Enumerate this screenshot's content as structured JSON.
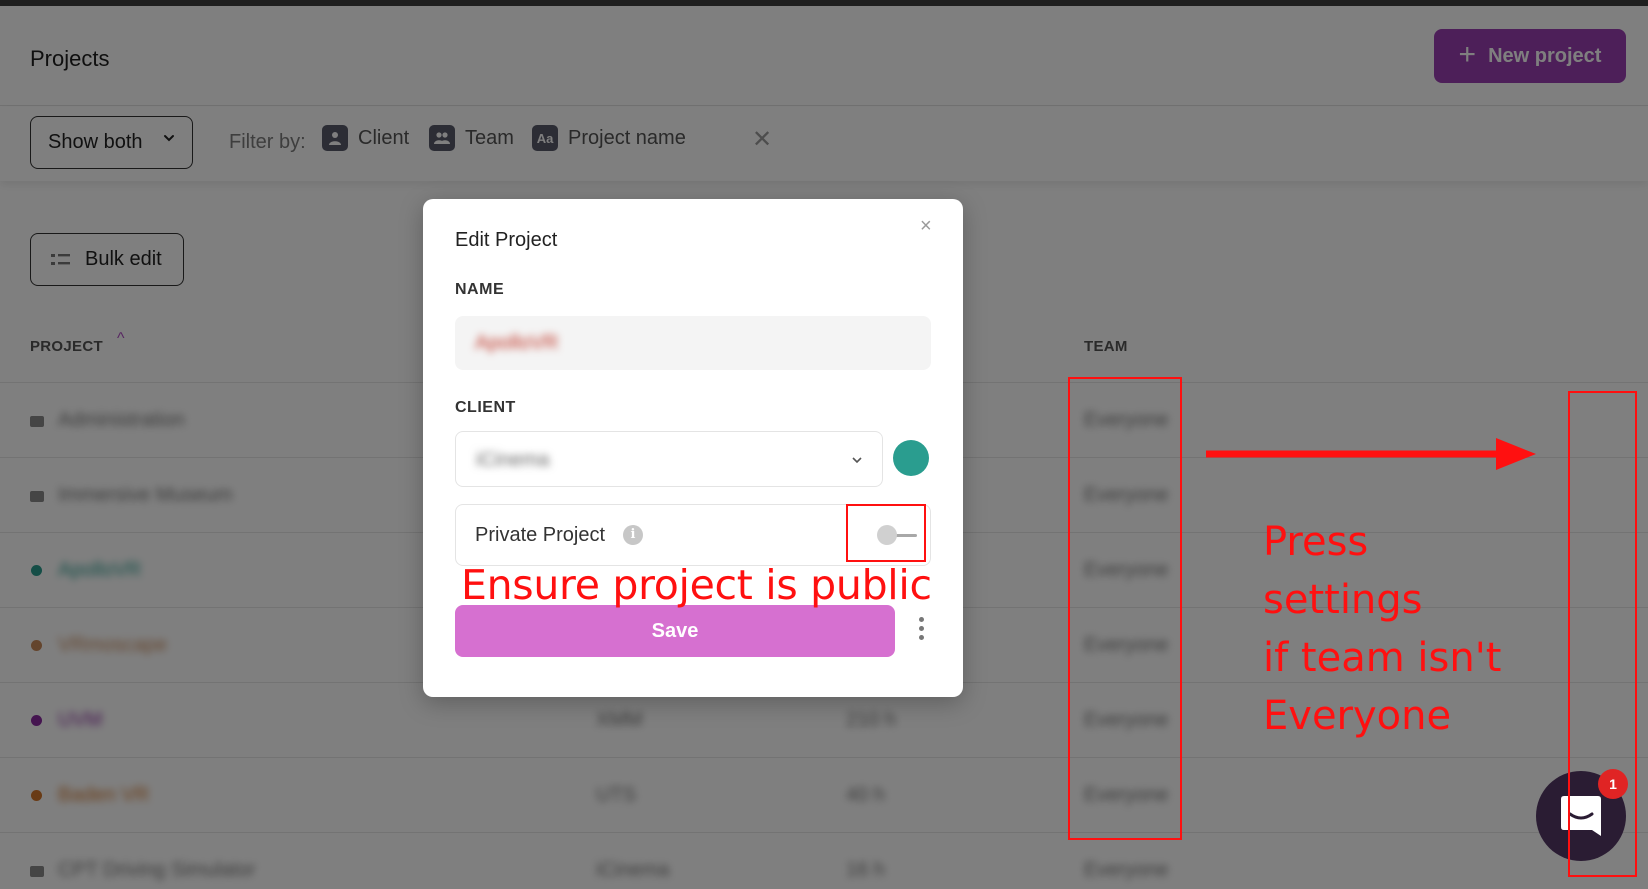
{
  "header": {
    "title": "Projects",
    "new_project_label": "New project"
  },
  "filters": {
    "show_select_value": "Show both",
    "filter_by_label": "Filter by:",
    "items": [
      {
        "label": "Client",
        "icon": "client-icon"
      },
      {
        "label": "Team",
        "icon": "team-icon"
      },
      {
        "label": "Project name",
        "icon": "project-name-icon",
        "icon_text": "Aa"
      }
    ],
    "clear_symbol": "✕"
  },
  "toolbar": {
    "bulk_edit_label": "Bulk edit"
  },
  "table": {
    "columns": {
      "project": "PROJECT",
      "team": "TEAM"
    },
    "sort": "ascending",
    "rows": [
      {
        "project": "Administration",
        "client": "",
        "budget": "",
        "team": "Everyone",
        "marker": "archive",
        "color": "#8a8a8a"
      },
      {
        "project": "Immersive Museum",
        "client": "",
        "budget": "",
        "team": "Everyone",
        "marker": "archive",
        "color": "#8a8a8a"
      },
      {
        "project": "ApolloVR",
        "client": "",
        "budget": "",
        "team": "Everyone",
        "marker": "dot",
        "color": "#2a9d8f"
      },
      {
        "project": "VRmoscape",
        "client": "",
        "budget": "",
        "team": "Everyone",
        "marker": "dot",
        "color": "#c98a5a"
      },
      {
        "project": "UVM",
        "client": "XMM",
        "budget": "210 h",
        "team": "Everyone",
        "marker": "dot",
        "color": "#8a2aa0"
      },
      {
        "project": "Baden VR",
        "client": "UTS",
        "budget": "40 h",
        "team": "Everyone",
        "marker": "dot",
        "color": "#d2762a"
      },
      {
        "project": "CPT Driving Simulator",
        "client": "iCinema",
        "budget": "16 h",
        "team": "Everyone",
        "marker": "archive",
        "color": "#8a8a8a"
      }
    ]
  },
  "modal": {
    "title": "Edit Project",
    "close_symbol": "×",
    "name_label": "NAME",
    "name_value": "ApolloVR",
    "client_label": "CLIENT",
    "client_value": "iCinema",
    "client_color": "#2a9d8f",
    "private_label": "Private Project",
    "private_enabled": false,
    "info_symbol": "i",
    "save_label": "Save"
  },
  "annotations": {
    "public_note": "Ensure project is public",
    "settings_note": [
      "Press",
      "settings",
      "if team isn't",
      "Everyone"
    ],
    "color": "#ff1010"
  },
  "chat": {
    "badge_count": "1"
  },
  "colors": {
    "accent": "#9b3fb3",
    "save_button": "#d670d0",
    "annotation": "#ff1010"
  }
}
